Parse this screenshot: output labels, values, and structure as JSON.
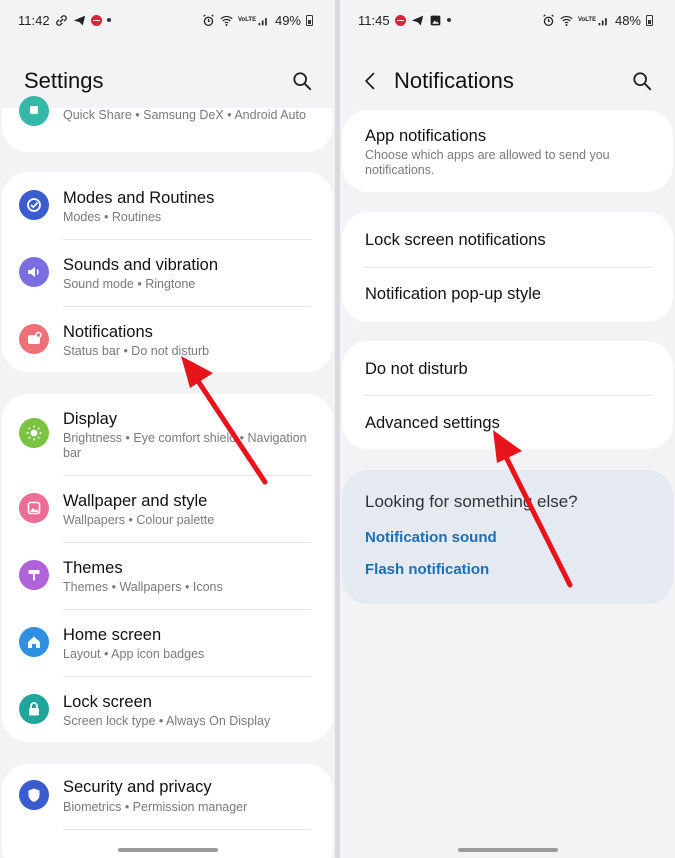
{
  "left": {
    "status": {
      "time": "11:42",
      "battery": "49%",
      "volte": "VoLTE"
    },
    "header": {
      "title": "Settings"
    },
    "top_item": {
      "subtitle": "Quick Share • Samsung DeX • Android Auto"
    },
    "items": [
      {
        "title": "Modes and Routines",
        "subtitle": "Modes • Routines",
        "icon": "modes-icon",
        "color": "#3b5ccc"
      },
      {
        "title": "Sounds and vibration",
        "subtitle": "Sound mode • Ringtone",
        "icon": "sound-icon",
        "color": "#7b6ee0"
      },
      {
        "title": "Notifications",
        "subtitle": "Status bar • Do not disturb",
        "icon": "notification-icon",
        "color": "#f0707a"
      },
      {
        "title": "Display",
        "subtitle": "Brightness • Eye comfort shield • Navigation bar",
        "icon": "display-icon",
        "color": "#7cc242"
      },
      {
        "title": "Wallpaper and style",
        "subtitle": "Wallpapers • Colour palette",
        "icon": "wallpaper-icon",
        "color": "#ec6d95"
      },
      {
        "title": "Themes",
        "subtitle": "Themes • Wallpapers • Icons",
        "icon": "themes-icon",
        "color": "#b062d8"
      },
      {
        "title": "Home screen",
        "subtitle": "Layout • App icon badges",
        "icon": "home-icon",
        "color": "#2f8fe0"
      },
      {
        "title": "Lock screen",
        "subtitle": "Screen lock type • Always On Display",
        "icon": "lock-icon",
        "color": "#21a59a"
      },
      {
        "title": "Security and privacy",
        "subtitle": "Biometrics • Permission manager",
        "icon": "shield-icon",
        "color": "#3b5ccc"
      }
    ]
  },
  "right": {
    "status": {
      "time": "11:45",
      "battery": "48%",
      "volte": "VoLTE"
    },
    "header": {
      "title": "Notifications"
    },
    "app_notifications": {
      "title": "App notifications",
      "subtitle": "Choose which apps are allowed to send you notifications."
    },
    "items": [
      {
        "title": "Lock screen notifications"
      },
      {
        "title": "Notification pop-up style"
      },
      {
        "title": "Do not disturb"
      },
      {
        "title": "Advanced settings"
      }
    ],
    "suggest": {
      "title": "Looking for something else?",
      "links": [
        "Notification sound",
        "Flash notification"
      ]
    }
  },
  "colors": {
    "arrow": "#e8141c",
    "link": "#1a6fb5"
  }
}
